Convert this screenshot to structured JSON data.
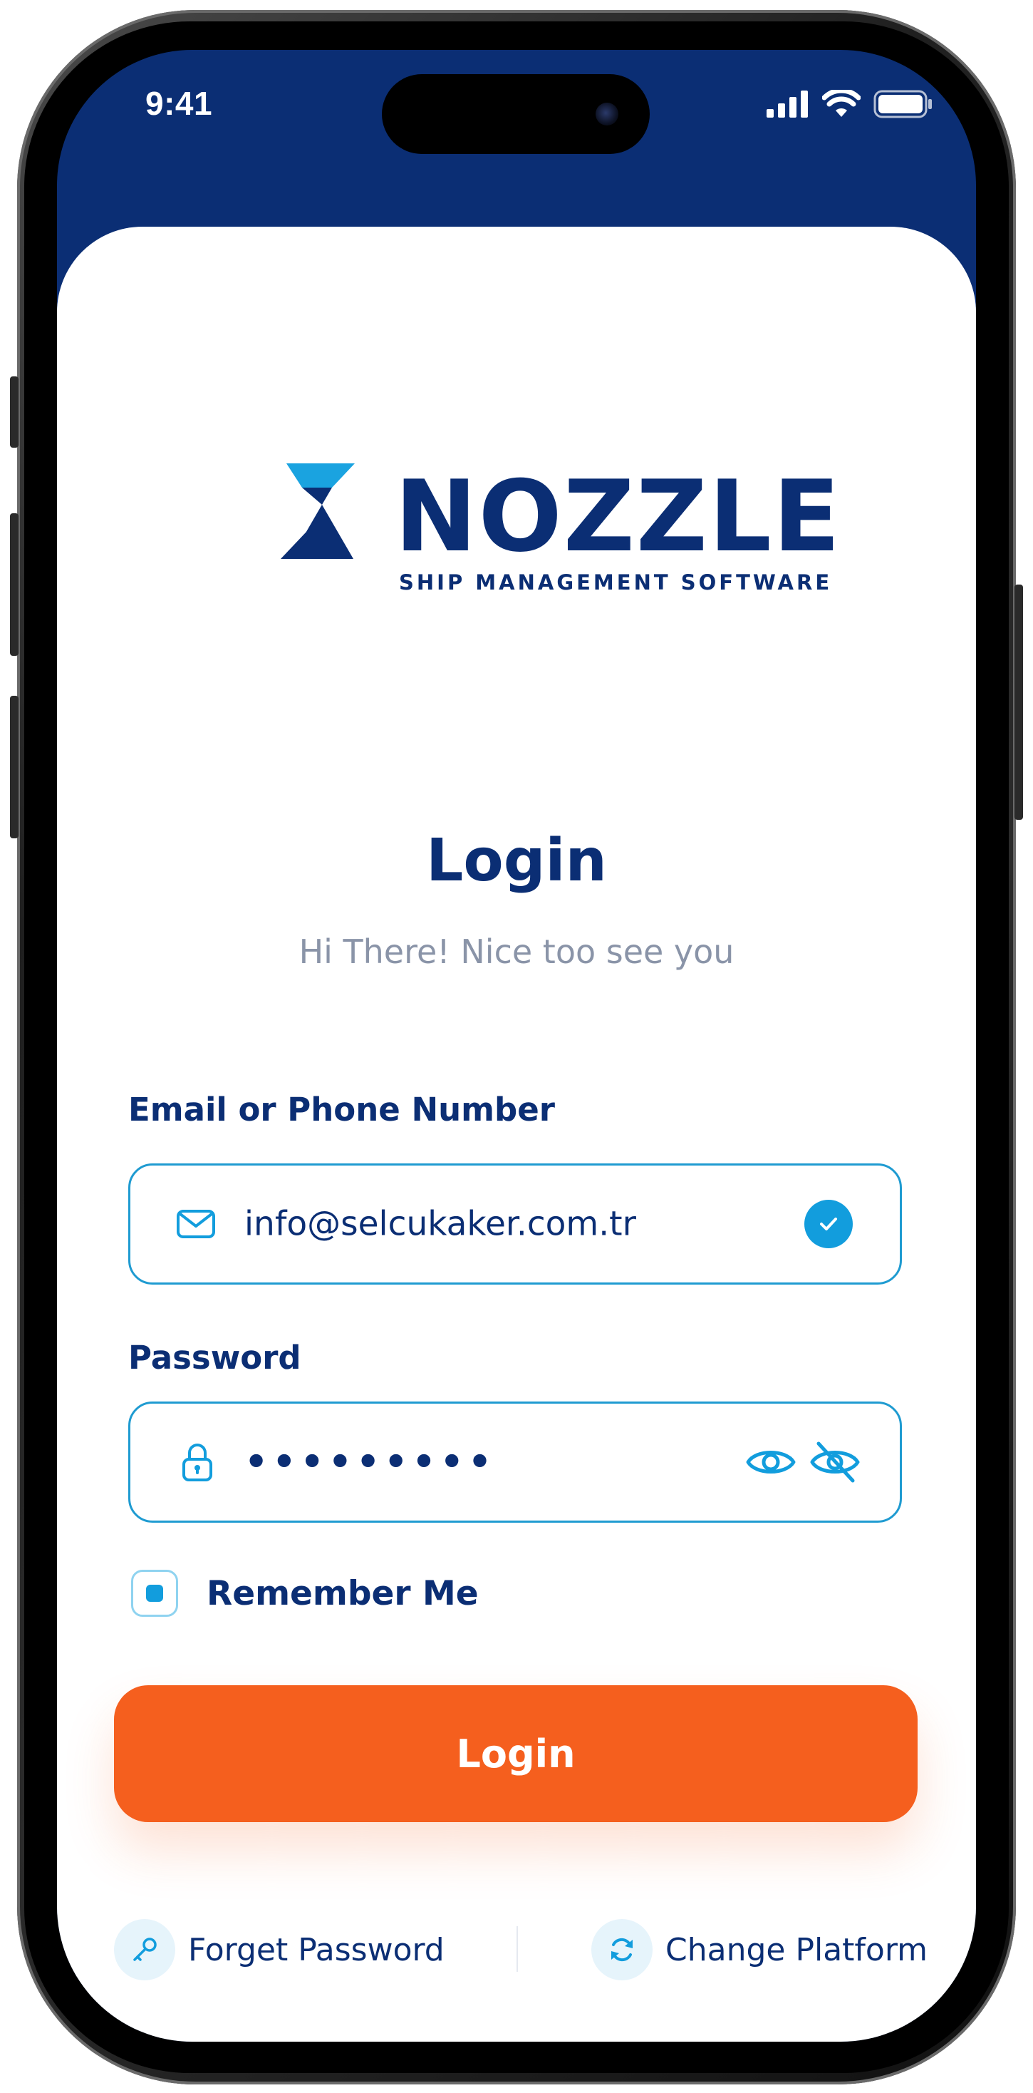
{
  "status_bar": {
    "time": "9:41"
  },
  "brand": {
    "name": "NOZZLE",
    "tagline": "SHIP MANAGEMENT SOFTWARE"
  },
  "header": {
    "title": "Login",
    "subtitle": "Hi There! Nice too see you"
  },
  "form": {
    "email_label": "Email or Phone Number",
    "email_value": "info@selcukaker.com.tr",
    "password_label": "Password",
    "password_value": "•••••••••",
    "remember_label": "Remember Me",
    "remember_checked": true,
    "login_button": "Login"
  },
  "footer": {
    "forget_password": "Forget Password",
    "change_platform": "Change Platform"
  },
  "colors": {
    "primary_navy": "#0b2e74",
    "accent_blue": "#129ddd",
    "button_orange": "#f55f1e",
    "subtitle_gray": "#8a94a8"
  },
  "icons": {
    "email": "mail-icon",
    "password": "lock-icon",
    "valid": "check-circle-icon",
    "show_password": "eye-icon",
    "hide_password": "eye-off-icon",
    "forget_password": "key-icon",
    "change_platform": "refresh-icon"
  }
}
